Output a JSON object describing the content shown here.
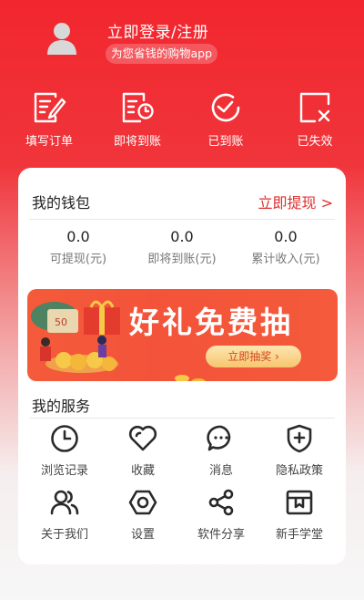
{
  "profile": {
    "login_label": "立即登录/注册",
    "tagline": "为您省钱的购物app"
  },
  "orders": [
    {
      "label": "填写订单",
      "icon": "edit-order-icon"
    },
    {
      "label": "即将到账",
      "icon": "pending-icon"
    },
    {
      "label": "已到账",
      "icon": "check-circle-icon"
    },
    {
      "label": "已失效",
      "icon": "invalid-icon"
    }
  ],
  "wallet": {
    "title": "我的钱包",
    "withdraw_label": "立即提现 >",
    "stats": [
      {
        "value": "0.0",
        "label": "可提现(元)"
      },
      {
        "value": "0.0",
        "label": "即将到账(元)"
      },
      {
        "value": "0.0",
        "label": "累计收入(元)"
      }
    ]
  },
  "banner": {
    "title": "好礼免费抽",
    "button_label": "立即抽奖 ›"
  },
  "services": {
    "title": "我的服务",
    "items": [
      {
        "label": "浏览记录",
        "icon": "clock-icon"
      },
      {
        "label": "收藏",
        "icon": "heart-icon"
      },
      {
        "label": "消息",
        "icon": "message-icon"
      },
      {
        "label": "隐私政策",
        "icon": "shield-plus-icon"
      },
      {
        "label": "关于我们",
        "icon": "users-icon"
      },
      {
        "label": "设置",
        "icon": "settings-icon"
      },
      {
        "label": "软件分享",
        "icon": "share-icon"
      },
      {
        "label": "新手学堂",
        "icon": "bookmark-icon"
      }
    ]
  },
  "colors": {
    "brand_red": "#f2262e",
    "accent_text": "#e02d2d"
  }
}
